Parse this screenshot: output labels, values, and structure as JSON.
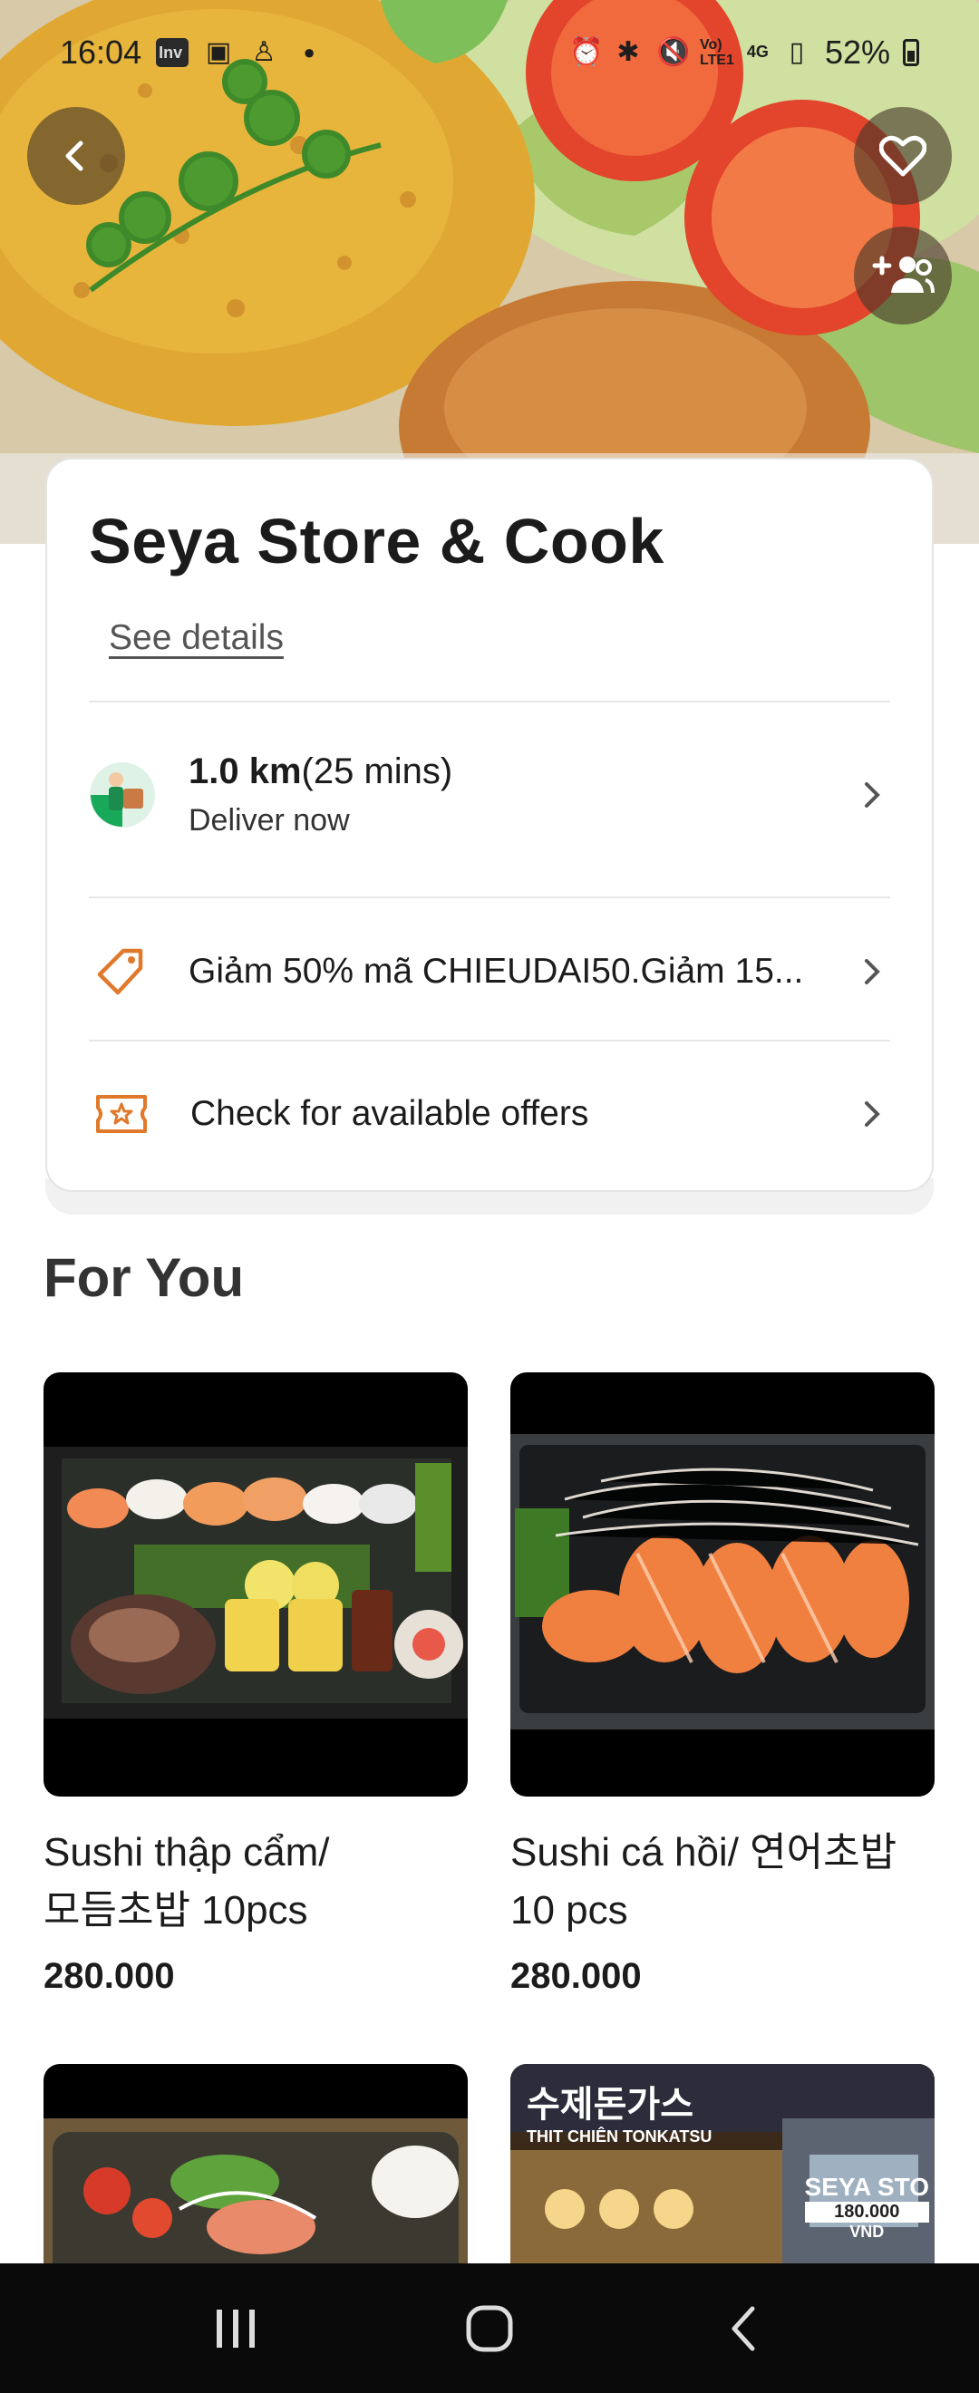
{
  "status_bar": {
    "time": "16:04",
    "left_icons": [
      "inv-app-icon",
      "card-icon",
      "person-icon",
      "dot-icon"
    ],
    "network_label_top": "Vo)",
    "network_label_bottom": "LTE1",
    "data_label": "4G",
    "battery_percent": "52%",
    "right_icons": [
      "alarm-icon",
      "bluetooth-icon",
      "mute-icon",
      "signal-icon",
      "battery-icon"
    ]
  },
  "hero": {
    "image": "fried-rice-chicken-photo",
    "back_icon": "chevron-left-icon",
    "favorite_icon": "heart-icon",
    "group_order_icon": "add-group-icon"
  },
  "store": {
    "name": "Seya Store & Cook",
    "see_details": "See details",
    "distance_bold": "1.0 km",
    "distance_time": "(25 mins)",
    "delivery_mode": "Deliver now",
    "promo_text": "Giảm 50% mã CHIEUDAI50.Giảm 15...",
    "offers_text": "Check for available offers"
  },
  "section": {
    "title": "For You"
  },
  "products": [
    {
      "name_line1": "Sushi thập cẩm/",
      "name_line2": "모듬초밥 10pcs",
      "price": "280.000"
    },
    {
      "name_line1": "Sushi cá hồi/ 연어초밥",
      "name_line2": "10 pcs",
      "price": "280.000"
    }
  ],
  "partial_products": [
    {
      "image": "salad-photo"
    },
    {
      "image": "tonkatsu-store-photo",
      "sign_line1": "수제돈가스",
      "sign_line2": "THIT CHIÊN TONKATSU",
      "store_text": "SEYA STO",
      "price_text": "180.000",
      "currency": "VND"
    }
  ],
  "colors": {
    "accent_orange": "#e0792b",
    "text_dark": "#1c1c1c",
    "navbar": "#0a0a0a"
  },
  "navbar": {
    "buttons": [
      "recent-apps-icon",
      "home-icon",
      "back-icon"
    ]
  }
}
